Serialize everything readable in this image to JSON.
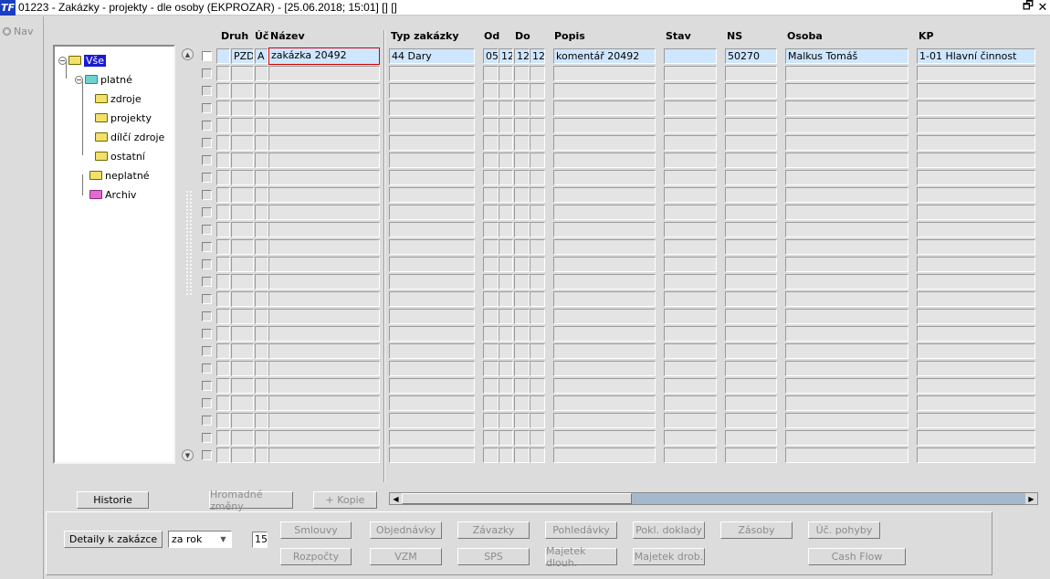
{
  "window": {
    "title": "01223 - Zakázky - projekty - dle osoby (EKPROZAR) - [25.06.2018; 15:01] [] []",
    "logo_text": "TF",
    "restore_glyph": "🗗",
    "close_glyph": "✕"
  },
  "nav": {
    "label": "Nav"
  },
  "tree": {
    "root": "Vše",
    "platne": "platné",
    "zdroje": "zdroje",
    "projekty": "projekty",
    "dilci": "dílčí zdroje",
    "ostatni": "ostatní",
    "neplatne": "neplatné",
    "archiv": "Archiv"
  },
  "columns": {
    "druh": "Druh",
    "uc": "Úč",
    "nazev": "Název",
    "typ": "Typ zakázky",
    "od": "Od",
    "do": "Do",
    "popis": "Popis",
    "stav": "Stav",
    "ns": "NS",
    "osoba": "Osoba",
    "kp": "KP"
  },
  "row1": {
    "druh": "PZD",
    "uc": "A",
    "nazev": "zakázka 20492",
    "typ": "44 Dary",
    "od1": "05",
    "od2": "12",
    "do1": "12",
    "do2": "12",
    "popis": "komentář 20492",
    "stav": "",
    "ns": "50270",
    "osoba": "Malkus Tomáš",
    "kp": "1-01 Hlavní činnost"
  },
  "buttons": {
    "historie": "Historie",
    "hromadne": "Hromadné změny",
    "kopie": "+ Kopie",
    "detaily": "Detaily k zakázce",
    "smlouvy": "Smlouvy",
    "objednavky": "Objednávky",
    "zavazky": "Závazky",
    "pohledavky": "Pohledávky",
    "pokl": "Pokl. doklady",
    "zasoby": "Zásoby",
    "ucpohyby": "Úč. pohyby",
    "rozpocty": "Rozpočty",
    "vzm": "VZM",
    "sps": "SPS",
    "majdlouh": "Majetek dlouh.",
    "majdrob": "Majetek drob.",
    "cashflow": "Cash Flow"
  },
  "period": {
    "selected": "za rok",
    "value": "15"
  }
}
